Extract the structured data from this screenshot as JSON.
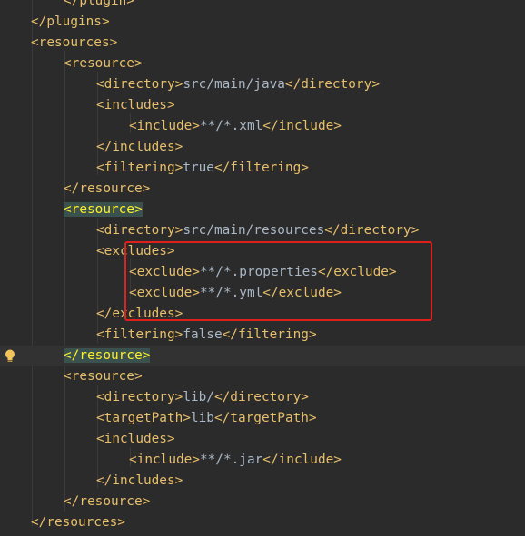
{
  "editor": {
    "lines": [
      {
        "indent": 3,
        "parts": [
          {
            "t": "</plugin>",
            "c": "tag"
          }
        ]
      },
      {
        "indent": 2,
        "parts": [
          {
            "t": "</plugins>",
            "c": "tag"
          }
        ]
      },
      {
        "indent": 2,
        "parts": [
          {
            "t": "<resources>",
            "c": "tag"
          }
        ]
      },
      {
        "indent": 3,
        "parts": [
          {
            "t": "<resource>",
            "c": "tag"
          }
        ]
      },
      {
        "indent": 4,
        "parts": [
          {
            "t": "<directory>",
            "c": "tag"
          },
          {
            "t": "src/main/java",
            "c": "text"
          },
          {
            "t": "</directory>",
            "c": "tag"
          }
        ]
      },
      {
        "indent": 4,
        "parts": [
          {
            "t": "<includes>",
            "c": "tag"
          }
        ]
      },
      {
        "indent": 5,
        "parts": [
          {
            "t": "<include>",
            "c": "tag"
          },
          {
            "t": "**/*.xml",
            "c": "text"
          },
          {
            "t": "</include>",
            "c": "tag"
          }
        ]
      },
      {
        "indent": 4,
        "parts": [
          {
            "t": "</includes>",
            "c": "tag"
          }
        ]
      },
      {
        "indent": 4,
        "parts": [
          {
            "t": "<filtering>",
            "c": "tag"
          },
          {
            "t": "true",
            "c": "text"
          },
          {
            "t": "</filtering>",
            "c": "tag"
          }
        ]
      },
      {
        "indent": 3,
        "parts": [
          {
            "t": "</resource>",
            "c": "tag"
          }
        ]
      },
      {
        "indent": 3,
        "parts": [
          {
            "t": "<resource>",
            "c": "tag",
            "match": true
          }
        ]
      },
      {
        "indent": 4,
        "parts": [
          {
            "t": "<directory>",
            "c": "tag"
          },
          {
            "t": "src/main/resources",
            "c": "text"
          },
          {
            "t": "</directory>",
            "c": "tag"
          }
        ]
      },
      {
        "indent": 4,
        "parts": [
          {
            "t": "<excludes>",
            "c": "tag"
          }
        ]
      },
      {
        "indent": 5,
        "parts": [
          {
            "t": "<exclude>",
            "c": "tag"
          },
          {
            "t": "**/*.properties",
            "c": "text"
          },
          {
            "t": "</exclude>",
            "c": "tag"
          }
        ]
      },
      {
        "indent": 5,
        "parts": [
          {
            "t": "<exclude>",
            "c": "tag"
          },
          {
            "t": "**/*.yml",
            "c": "text"
          },
          {
            "t": "</exclude>",
            "c": "tag"
          }
        ]
      },
      {
        "indent": 4,
        "parts": [
          {
            "t": "</excludes>",
            "c": "tag"
          }
        ]
      },
      {
        "indent": 4,
        "parts": [
          {
            "t": "<filtering>",
            "c": "tag"
          },
          {
            "t": "false",
            "c": "text"
          },
          {
            "t": "</filtering>",
            "c": "tag"
          }
        ]
      },
      {
        "indent": 3,
        "current": true,
        "bulb": true,
        "parts": [
          {
            "t": "</resource>",
            "c": "tag",
            "match": true
          }
        ]
      },
      {
        "indent": 3,
        "parts": [
          {
            "t": "<resource>",
            "c": "tag"
          }
        ]
      },
      {
        "indent": 4,
        "parts": [
          {
            "t": "<directory>",
            "c": "tag"
          },
          {
            "t": "lib/",
            "c": "text"
          },
          {
            "t": "</directory>",
            "c": "tag"
          }
        ]
      },
      {
        "indent": 4,
        "parts": [
          {
            "t": "<targetPath>",
            "c": "tag"
          },
          {
            "t": "lib",
            "c": "text"
          },
          {
            "t": "</targetPath>",
            "c": "tag"
          }
        ]
      },
      {
        "indent": 4,
        "parts": [
          {
            "t": "<includes>",
            "c": "tag"
          }
        ]
      },
      {
        "indent": 5,
        "parts": [
          {
            "t": "<include>",
            "c": "tag"
          },
          {
            "t": "**/*.jar",
            "c": "text"
          },
          {
            "t": "</include>",
            "c": "tag"
          }
        ]
      },
      {
        "indent": 4,
        "parts": [
          {
            "t": "</includes>",
            "c": "tag"
          }
        ]
      },
      {
        "indent": 3,
        "parts": [
          {
            "t": "</resource>",
            "c": "tag"
          }
        ]
      },
      {
        "indent": 2,
        "parts": [
          {
            "t": "</resources>",
            "c": "tag"
          }
        ]
      }
    ]
  },
  "colors": {
    "background": "#2b2b2b",
    "tag": "#e8bf6a",
    "text": "#a9b7c6",
    "bracket_match_bg": "#3b514d",
    "bracket_match_fg": "#ffef28",
    "current_line": "#323232",
    "annotation_box": "#e0201c",
    "intention_bulb": "#f2c55c"
  },
  "icons": {
    "intention": "lightbulb-icon"
  }
}
